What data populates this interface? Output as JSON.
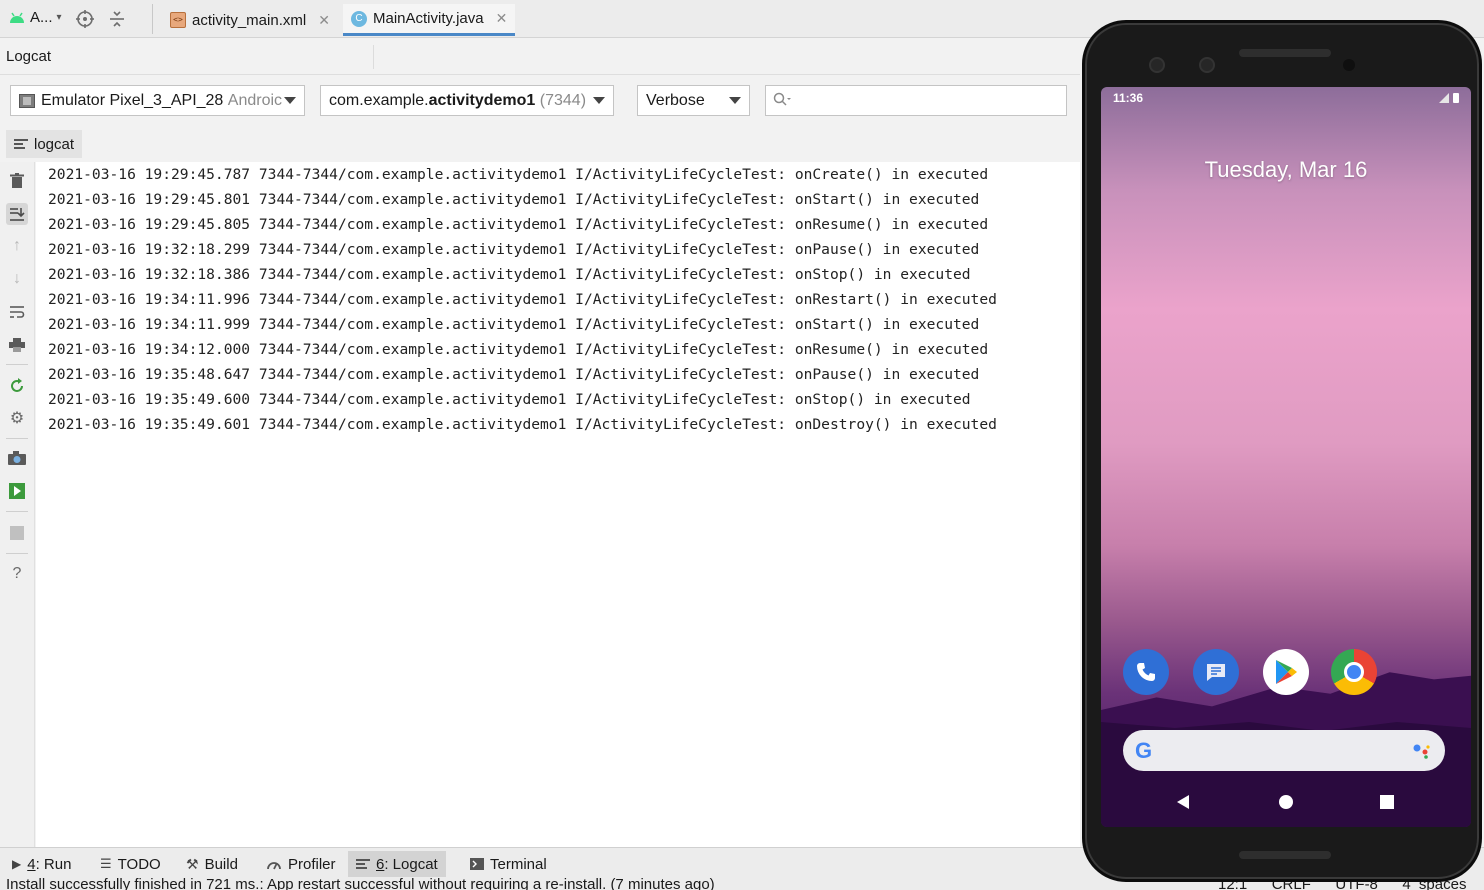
{
  "project": {
    "label": "A..."
  },
  "editor_tabs": [
    {
      "label": "activity_main.xml",
      "active": false
    },
    {
      "label": "MainActivity.java",
      "active": true
    }
  ],
  "logcat": {
    "title": "Logcat",
    "device": "Emulator Pixel_3_API_28",
    "device_suffix": "Androic",
    "process_prefix": "com.example.",
    "process_bold": "activitydemo1",
    "process_pid": "(7344)",
    "log_level": "Verbose",
    "search_value": "",
    "subtab": "logcat",
    "lines": [
      "2021-03-16 19:29:45.787 7344-7344/com.example.activitydemo1 I/ActivityLifeCycleTest: onCreate() in executed",
      "2021-03-16 19:29:45.801 7344-7344/com.example.activitydemo1 I/ActivityLifeCycleTest: onStart() in executed",
      "2021-03-16 19:29:45.805 7344-7344/com.example.activitydemo1 I/ActivityLifeCycleTest: onResume() in executed",
      "2021-03-16 19:32:18.299 7344-7344/com.example.activitydemo1 I/ActivityLifeCycleTest: onPause() in executed",
      "2021-03-16 19:32:18.386 7344-7344/com.example.activitydemo1 I/ActivityLifeCycleTest: onStop() in executed",
      "2021-03-16 19:34:11.996 7344-7344/com.example.activitydemo1 I/ActivityLifeCycleTest: onRestart() in executed",
      "2021-03-16 19:34:11.999 7344-7344/com.example.activitydemo1 I/ActivityLifeCycleTest: onStart() in executed",
      "2021-03-16 19:34:12.000 7344-7344/com.example.activitydemo1 I/ActivityLifeCycleTest: onResume() in executed",
      "2021-03-16 19:35:48.647 7344-7344/com.example.activitydemo1 I/ActivityLifeCycleTest: onPause() in executed",
      "2021-03-16 19:35:49.600 7344-7344/com.example.activitydemo1 I/ActivityLifeCycleTest: onStop() in executed",
      "2021-03-16 19:35:49.601 7344-7344/com.example.activitydemo1 I/ActivityLifeCycleTest: onDestroy() in executed"
    ]
  },
  "bottom_tabs": [
    {
      "num": "4",
      "label": ": Run"
    },
    {
      "num": "",
      "label": "TODO"
    },
    {
      "num": "",
      "label": "Build"
    },
    {
      "num": "",
      "label": "Profiler"
    },
    {
      "num": "6",
      "label": ": Logcat"
    },
    {
      "num": "",
      "label": "Terminal"
    }
  ],
  "status": {
    "message": "Install successfully finished in 721 ms.: App restart successful without requiring a re-install. (7 minutes ago)",
    "position": "12:1",
    "line_sep": "CRLF",
    "encoding": "UTF-8",
    "indent": "4 spaces"
  },
  "device_screen": {
    "time": "11:36",
    "date": "Tuesday, Mar 16"
  },
  "colors": {
    "accent": "#4a88c7",
    "run_green": "#3c9a3c"
  }
}
